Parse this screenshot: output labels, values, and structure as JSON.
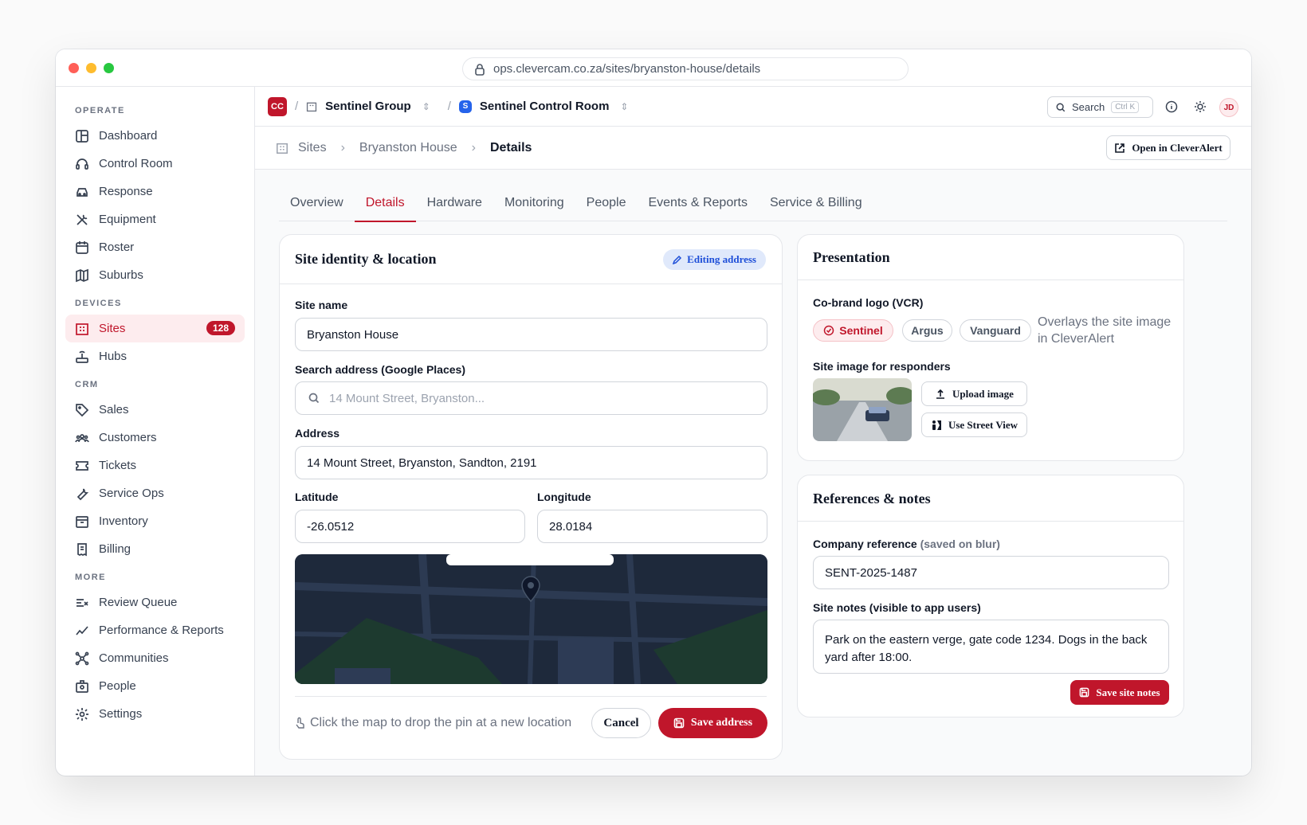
{
  "browser": {
    "url": "ops.clevercam.co.za/sites/bryanston-house/details"
  },
  "sidebar": {
    "sections": [
      {
        "title": "OPERATE",
        "items": [
          {
            "label": "Dashboard",
            "icon": "dashboard-icon"
          },
          {
            "label": "Control Room",
            "icon": "headset-icon"
          },
          {
            "label": "Response",
            "icon": "car-icon"
          },
          {
            "label": "Equipment",
            "icon": "tools-icon"
          },
          {
            "label": "Roster",
            "icon": "calendar-icon"
          },
          {
            "label": "Suburbs",
            "icon": "map-icon"
          }
        ]
      },
      {
        "title": "DEVICES",
        "items": [
          {
            "label": "Sites",
            "icon": "building-icon",
            "badge": "128",
            "active": true
          },
          {
            "label": "Hubs",
            "icon": "router-icon"
          }
        ]
      },
      {
        "title": "CRM",
        "items": [
          {
            "label": "Sales",
            "icon": "tag-icon"
          },
          {
            "label": "Customers",
            "icon": "users-icon"
          },
          {
            "label": "Tickets",
            "icon": "ticket-icon"
          },
          {
            "label": "Service Ops",
            "icon": "wrench-icon"
          },
          {
            "label": "Inventory",
            "icon": "archive-icon"
          },
          {
            "label": "Billing",
            "icon": "receipt-icon"
          }
        ]
      },
      {
        "title": "MORE",
        "items": [
          {
            "label": "Review Queue",
            "icon": "list-check-icon"
          },
          {
            "label": "Performance & Reports",
            "icon": "trend-icon"
          },
          {
            "label": "Communities",
            "icon": "network-icon"
          },
          {
            "label": "People",
            "icon": "id-badge-icon"
          },
          {
            "label": "Settings",
            "icon": "gear-icon"
          }
        ]
      }
    ]
  },
  "topbar": {
    "logo": "CC",
    "org": "Sentinel Group",
    "room_badge": "S",
    "room": "Sentinel Control Room",
    "search_label": "Search",
    "search_shortcut": "Ctrl K",
    "avatar": "JD"
  },
  "breadcrumb": {
    "root": "Sites",
    "site": "Bryanston House",
    "current": "Details",
    "open_button": "Open in CleverAlert"
  },
  "tabs": [
    "Overview",
    "Details",
    "Hardware",
    "Monitoring",
    "People",
    "Events & Reports",
    "Service & Billing"
  ],
  "identity": {
    "title": "Site identity & location",
    "editing_badge": "Editing address",
    "site_name_label": "Site name",
    "site_name": "Bryanston House",
    "search_label": "Search address (Google Places)",
    "search_placeholder": "14 Mount Street, Bryanston...",
    "address_label": "Address",
    "address": "14 Mount Street, Bryanston, Sandton, 2191",
    "lat_label": "Latitude",
    "lat": "-26.0512",
    "lng_label": "Longitude",
    "lng": "28.0184",
    "map_hint": "Click the map to drop the pin at a new location",
    "cancel": "Cancel",
    "save": "Save address"
  },
  "presentation": {
    "title": "Presentation",
    "cobrand_label": "Co-brand logo (VCR)",
    "brands": [
      "Sentinel",
      "Argus",
      "Vanguard"
    ],
    "cobrand_note": "Overlays the site image in CleverAlert",
    "image_label": "Site image for responders",
    "upload": "Upload image",
    "street_view": "Use Street View"
  },
  "references": {
    "title": "References & notes",
    "company_ref_label": "Company reference",
    "company_ref_hint": "(saved on blur)",
    "company_ref": "SENT-2025-1487",
    "notes_label": "Site notes (visible to app users)",
    "notes": "Park on the eastern verge, gate code 1234. Dogs in the back yard after 18:00.",
    "save_notes": "Save site notes"
  },
  "colors": {
    "accent": "#c0162b",
    "blue": "#2563eb"
  }
}
